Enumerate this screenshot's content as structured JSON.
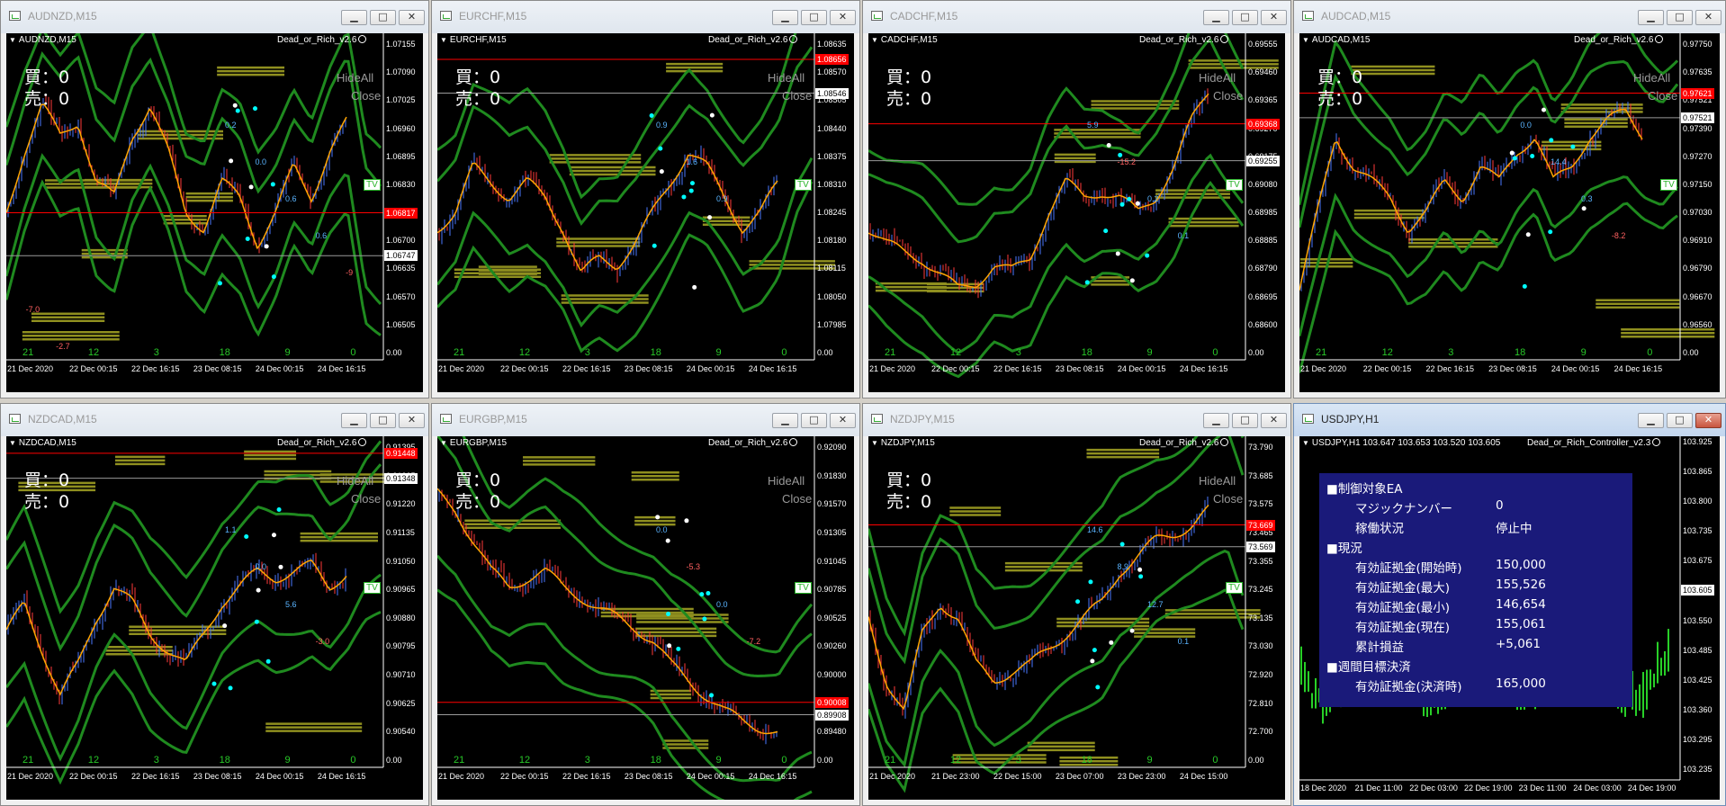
{
  "windows": [
    {
      "title": "AUDNZD,M15",
      "symbol": "AUDNZD,M15",
      "ea": "Dead_or_Rich_v2.6",
      "buy_label": "買：0",
      "sell_label": "売：0",
      "hide_all": "HideAll",
      "close": "Close",
      "tv": "TV",
      "prices": [
        "1.07155",
        "1.07090",
        "1.07025",
        "1.06960",
        "1.06895",
        "1.06830",
        "1.06765",
        "1.06700",
        "1.06635",
        "1.06570",
        "1.06505",
        "0.00"
      ],
      "red_price": "1.06817",
      "white_price": "1.06747",
      "hours": [
        "21",
        "12",
        "3",
        "18",
        "9",
        "0"
      ],
      "dates": [
        "21 Dec 2020",
        "22 Dec 00:15",
        "22 Dec 16:15",
        "23 Dec 08:15",
        "24 Dec 00:15",
        "24 Dec 16:15"
      ],
      "trade_labels": [
        "0.2",
        "0.0",
        "0.6",
        "0.6",
        "-9",
        "-7.0",
        "-2.7"
      ]
    },
    {
      "title": "EURCHF,M15",
      "symbol": "EURCHF,M15",
      "ea": "Dead_or_Rich_v2.6",
      "buy_label": "買：0",
      "sell_label": "売：0",
      "hide_all": "HideAll",
      "close": "Close",
      "tv": "TV",
      "prices": [
        "1.08635",
        "1.08570",
        "1.08505",
        "1.08440",
        "1.08375",
        "1.08310",
        "1.08245",
        "1.08180",
        "1.08115",
        "1.08050",
        "1.07985",
        "0.00"
      ],
      "red_price": "1.08656",
      "white_price": "1.08546",
      "hours": [
        "21",
        "12",
        "3",
        "18",
        "9",
        "0"
      ],
      "dates": [
        "21 Dec 2020",
        "22 Dec 00:15",
        "22 Dec 16:15",
        "23 Dec 08:15",
        "24 Dec 00:15",
        "24 Dec 16:15"
      ],
      "trade_labels": [
        "0.9",
        "1.6",
        "0.9"
      ]
    },
    {
      "title": "CADCHF,M15",
      "symbol": "CADCHF,M15",
      "ea": "Dead_or_Rich_v2.6",
      "buy_label": "買：0",
      "sell_label": "売：0",
      "hide_all": "HideAll",
      "close": "Close",
      "tv": "TV",
      "prices": [
        "0.69555",
        "0.69460",
        "0.69365",
        "0.69270",
        "0.69175",
        "0.69080",
        "0.68985",
        "0.68885",
        "0.68790",
        "0.68695",
        "0.68600",
        "0.00"
      ],
      "red_price": "0.69368",
      "white_price": "0.69255",
      "hours": [
        "21",
        "12",
        "3",
        "18",
        "9",
        "0"
      ],
      "dates": [
        "21 Dec 2020",
        "22 Dec 00:15",
        "22 Dec 16:15",
        "23 Dec 08:15",
        "24 Dec 00:15",
        "24 Dec 16:15"
      ],
      "trade_labels": [
        "5.9",
        "-15.2",
        "0.2",
        "0.1"
      ]
    },
    {
      "title": "AUDCAD,M15",
      "symbol": "AUDCAD,M15",
      "ea": "Dead_or_Rich_v2.6",
      "buy_label": "買：0",
      "sell_label": "売：0",
      "hide_all": "HideAll",
      "close": "Close",
      "tv": "TV",
      "prices": [
        "0.97750",
        "0.97635",
        "0.97521",
        "0.97390",
        "0.97270",
        "0.97150",
        "0.97030",
        "0.96910",
        "0.96790",
        "0.96670",
        "0.96560",
        "0.00"
      ],
      "red_price": "0.97621",
      "white_price": "0.97521",
      "hours": [
        "21",
        "12",
        "3",
        "18",
        "9",
        "0"
      ],
      "dates": [
        "21 Dec 2020",
        "22 Dec 00:15",
        "22 Dec 16:15",
        "23 Dec 08:15",
        "24 Dec 00:15",
        "24 Dec 16:15"
      ],
      "trade_labels": [
        "0.0",
        "14.4",
        "0.3",
        "-8.2"
      ]
    },
    {
      "title": "NZDCAD,M15",
      "symbol": "NZDCAD,M15",
      "ea": "Dead_or_Rich_v2.6",
      "buy_label": "買：0",
      "sell_label": "売：0",
      "hide_all": "HideAll",
      "close": "Close",
      "tv": "TV",
      "prices": [
        "0.91395",
        "0.91305",
        "0.91220",
        "0.91135",
        "0.91050",
        "0.90965",
        "0.90880",
        "0.90795",
        "0.90710",
        "0.90625",
        "0.90540",
        "0.00"
      ],
      "red_price": "0.91448",
      "white_price": "0.91348",
      "hours": [
        "21",
        "12",
        "3",
        "18",
        "9",
        "0"
      ],
      "dates": [
        "21 Dec 2020",
        "22 Dec 00:15",
        "22 Dec 16:15",
        "23 Dec 08:15",
        "24 Dec 00:15",
        "24 Dec 16:15"
      ],
      "trade_labels": [
        "1.1",
        "0.0",
        "5.6",
        "-3.0"
      ]
    },
    {
      "title": "EURGBP,M15",
      "symbol": "EURGBP,M15",
      "ea": "Dead_or_Rich_v2.6",
      "buy_label": "買：0",
      "sell_label": "売：0",
      "hide_all": "HideAll",
      "close": "Close",
      "tv": "TV",
      "prices": [
        "0.92090",
        "0.91830",
        "0.91570",
        "0.91305",
        "0.91045",
        "0.90785",
        "0.90525",
        "0.90260",
        "0.90000",
        "0.89740",
        "0.89480",
        "0.00"
      ],
      "red_price": "0.90008",
      "white_price": "0.89908",
      "hours": [
        "21",
        "12",
        "3",
        "18",
        "9",
        "0"
      ],
      "dates": [
        "21 Dec 2020",
        "22 Dec 00:15",
        "22 Dec 16:15",
        "23 Dec 08:15",
        "24 Dec 00:15",
        "24 Dec 16:15"
      ],
      "trade_labels": [
        "0.0",
        "-5.3",
        "0.0",
        "-7.2"
      ]
    },
    {
      "title": "NZDJPY,M15",
      "symbol": "NZDJPY,M15",
      "ea": "Dead_or_Rich_v2.6",
      "buy_label": "買：0",
      "sell_label": "売：0",
      "hide_all": "HideAll",
      "close": "Close",
      "tv": "TV",
      "prices": [
        "73.790",
        "73.685",
        "73.575",
        "73.465",
        "73.355",
        "73.245",
        "73.135",
        "73.030",
        "72.920",
        "72.810",
        "72.700",
        "0.00"
      ],
      "red_price": "73.669",
      "white_price": "73.569",
      "hours": [
        "21",
        "12",
        "3",
        "18",
        "9",
        "0"
      ],
      "dates": [
        "21 Dec 2020",
        "21 Dec 23:00",
        "22 Dec 15:00",
        "23 Dec 07:00",
        "23 Dec 23:00",
        "24 Dec 15:00"
      ],
      "trade_labels": [
        "14.6",
        "8.9",
        "12.7",
        "0.1"
      ]
    }
  ],
  "controller": {
    "title": "USDJPY,H1",
    "info": "USDJPY,H1  103.647 103.653 103.520 103.605",
    "ea": "Dead_or_Rich_Controller_v2.3",
    "prices": [
      "103.925",
      "103.865",
      "103.800",
      "103.735",
      "103.675",
      "103.605",
      "103.550",
      "103.485",
      "103.425",
      "103.360",
      "103.295",
      "103.235"
    ],
    "current_price": "103.605",
    "dates": [
      "18 Dec 2020",
      "21 Dec 11:00",
      "22 Dec 03:00",
      "22 Dec 19:00",
      "23 Dec 11:00",
      "24 Dec 03:00",
      "24 Dec 19:00"
    ],
    "panel": {
      "s1": "■制御対象EA",
      "magic_label": "マジックナンバー",
      "magic_value": "0",
      "status_label": "稼働状況",
      "status_value": "停止中",
      "s2": "■現況",
      "eq_start_label": "有効証拠金(開始時)",
      "eq_start_value": "150,000",
      "eq_max_label": "有効証拠金(最大)",
      "eq_max_value": "155,526",
      "eq_min_label": "有効証拠金(最小)",
      "eq_min_value": "146,654",
      "eq_now_label": "有効証拠金(現在)",
      "eq_now_value": "155,061",
      "pl_label": "累計損益",
      "pl_value": "+5,061",
      "s3": "■週間目標決済",
      "eq_settle_label": "有効証拠金(決済時)",
      "eq_settle_value": "165,000"
    }
  },
  "colors": {
    "bg": "#000000",
    "band": "#1f8a1f",
    "ma": "#ffa500",
    "bull": "#4a78ff",
    "bear": "#ff3a3a",
    "sr": "#8f8f1f",
    "cyan": "#00ffff",
    "panel": "#1a1a7a"
  }
}
